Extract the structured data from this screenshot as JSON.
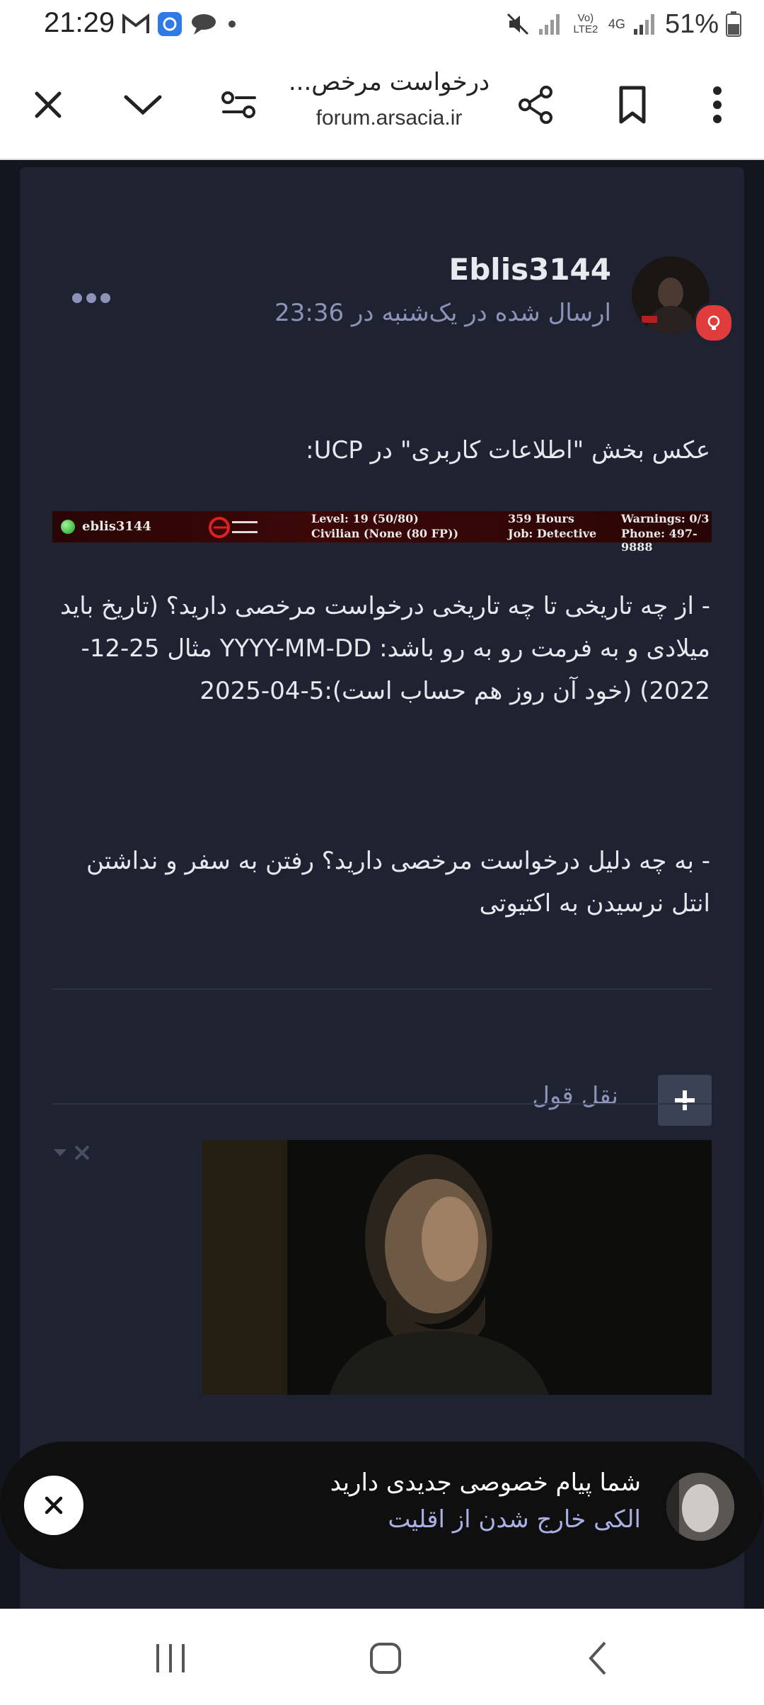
{
  "status_bar": {
    "time": "21:29",
    "battery": "51%",
    "network": "4G",
    "carrier": "Vo) LTE2",
    "icons": [
      "gmail-icon",
      "app-icon",
      "chat-icon",
      "dot-icon",
      "mute-icon",
      "signal-icon",
      "battery-icon"
    ]
  },
  "browser": {
    "page_title": "درخواست مرخص...",
    "host": "forum.arsacia.ir",
    "icons": [
      "close-icon",
      "chevron-down-icon",
      "page-settings-icon",
      "share-icon",
      "bookmark-icon",
      "more-vert-icon"
    ]
  },
  "post": {
    "author": "Eblis3144",
    "date": "ارسال شده در یک‌شنبه در 23:36",
    "line_ucp": "عکس بخش \"اطلاعات کاربری\" در UCP:",
    "ucp": {
      "name": "eblis3144",
      "level": "Level: 19 (50/80)",
      "status": "Civilian (None (80 FP))",
      "hours": "359 Hours",
      "job": "Job: Detective",
      "warnings": "Warnings: 0/3",
      "phone": "Phone: 497-9888"
    },
    "question_dates": "- از چه تاریخی تا چه تاریخی درخواست مرخصی دارید؟ (تاریخ باید میلادی و به فرمت رو به رو باشد: YYYY-MM-DD مثال 25-12-2022) (خود آن روز هم حساب است):5-04-2025",
    "question_reason": "- به چه دلیل درخواست مرخصی دارید؟ رفتن به سفر و نداشتن انتل نرسیدن به اکتیوتی",
    "quote_label": "نقل قول"
  },
  "toast": {
    "title": "شما پیام خصوصی جدیدی دارید",
    "message": "الکی خارج شدن از اقلیت"
  },
  "colors": {
    "background": "#13161f",
    "card": "#1f2331",
    "muted": "#8d93b8",
    "accent_red": "#e03c3c",
    "toast_link": "#a9b0e6"
  }
}
